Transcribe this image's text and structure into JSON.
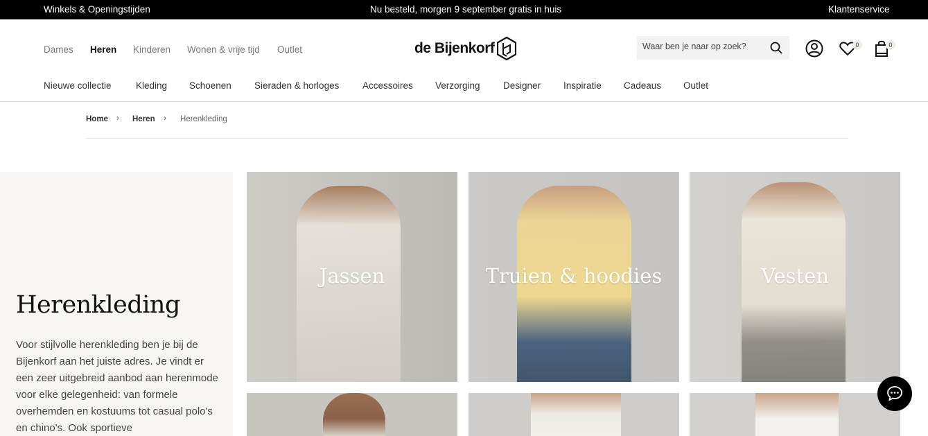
{
  "topbar": {
    "left": "Winkels & Openingstijden",
    "center": "Nu besteld, morgen 9 september gratis in huis",
    "right": "Klantenservice"
  },
  "header": {
    "gender_nav": [
      {
        "label": "Dames",
        "active": false
      },
      {
        "label": "Heren",
        "active": true
      },
      {
        "label": "Kinderen",
        "active": false
      },
      {
        "label": "Wonen & vrije tijd",
        "active": false
      },
      {
        "label": "Outlet",
        "active": false
      }
    ],
    "logo": "de Bijenkorf",
    "search": {
      "placeholder": "Waar ben je naar op zoek?",
      "value": ""
    },
    "icons": {
      "account": "user-icon",
      "wishlist": "heart-icon",
      "cart": "shopping-bag-icon"
    },
    "wishlist_count": "0",
    "cart_count": "0"
  },
  "category_nav": [
    "Nieuwe collectie",
    "Kleding",
    "Schoenen",
    "Sieraden & horloges",
    "Accessoires",
    "Verzorging",
    "Designer",
    "Inspiratie",
    "Cadeaus",
    "Outlet"
  ],
  "breadcrumb": {
    "items": [
      "Home",
      "Heren"
    ],
    "current": "Herenkleding"
  },
  "intro": {
    "title": "Herenkleding",
    "text": "Voor stijlvolle herenkleding ben je bij de Bijenkorf aan het juiste adres. Je vindt er een zeer uitgebreid aanbod aan herenmode voor elke gelegenheid: van formele overhemden en kostuums tot casual polo's en chino's. Ook sportieve"
  },
  "tiles": [
    {
      "label": "Jassen"
    },
    {
      "label": "Truien & hoodies"
    },
    {
      "label": "Vesten"
    }
  ],
  "colors": {
    "topbar": "#000000",
    "intro_bg": "#f8f6f2",
    "tile_bg": "#c9c7c3",
    "badge": "#f1ede6"
  },
  "chat": {
    "icon": "chat-bubble-icon"
  }
}
